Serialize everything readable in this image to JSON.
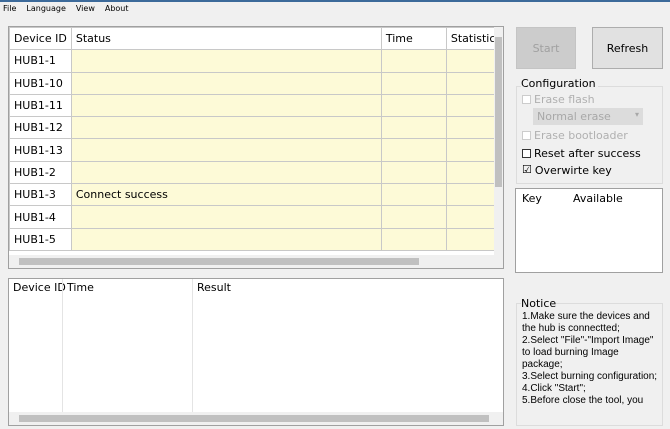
{
  "menu": [
    "File",
    "Language",
    "View",
    "About"
  ],
  "grid": {
    "columns": [
      "Device ID",
      "Status",
      "Time",
      "Statistic"
    ],
    "rows": [
      {
        "id": "HUB1-1",
        "status": ""
      },
      {
        "id": "HUB1-10",
        "status": ""
      },
      {
        "id": "HUB1-11",
        "status": ""
      },
      {
        "id": "HUB1-12",
        "status": ""
      },
      {
        "id": "HUB1-13",
        "status": ""
      },
      {
        "id": "HUB1-2",
        "status": ""
      },
      {
        "id": "HUB1-3",
        "status": "Connect success"
      },
      {
        "id": "HUB1-4",
        "status": ""
      },
      {
        "id": "HUB1-5",
        "status": ""
      }
    ]
  },
  "log": {
    "columns": [
      "Device ID",
      "Time",
      "Result"
    ]
  },
  "buttons": {
    "start": "Start",
    "refresh": "Refresh"
  },
  "config": {
    "title": "Configuration",
    "erase_flash": "Erase flash",
    "erase_mode": "Normal erase",
    "erase_bootloader": "Erase bootloader",
    "reset_after": "Reset after success",
    "overwrite_key": "Overwirte key",
    "overwrite_checked": "☑"
  },
  "keys": {
    "columns": [
      "Key",
      "Available"
    ]
  },
  "notice": {
    "title": "Notice",
    "text": "1.Make sure the devices and the hub is connectted;\n2.Select \"File\"-\"Import Image\" to load burning Image package;\n3.Select burning configuration;\n4.Click \"Start\";\n5.Before close the tool, you"
  }
}
